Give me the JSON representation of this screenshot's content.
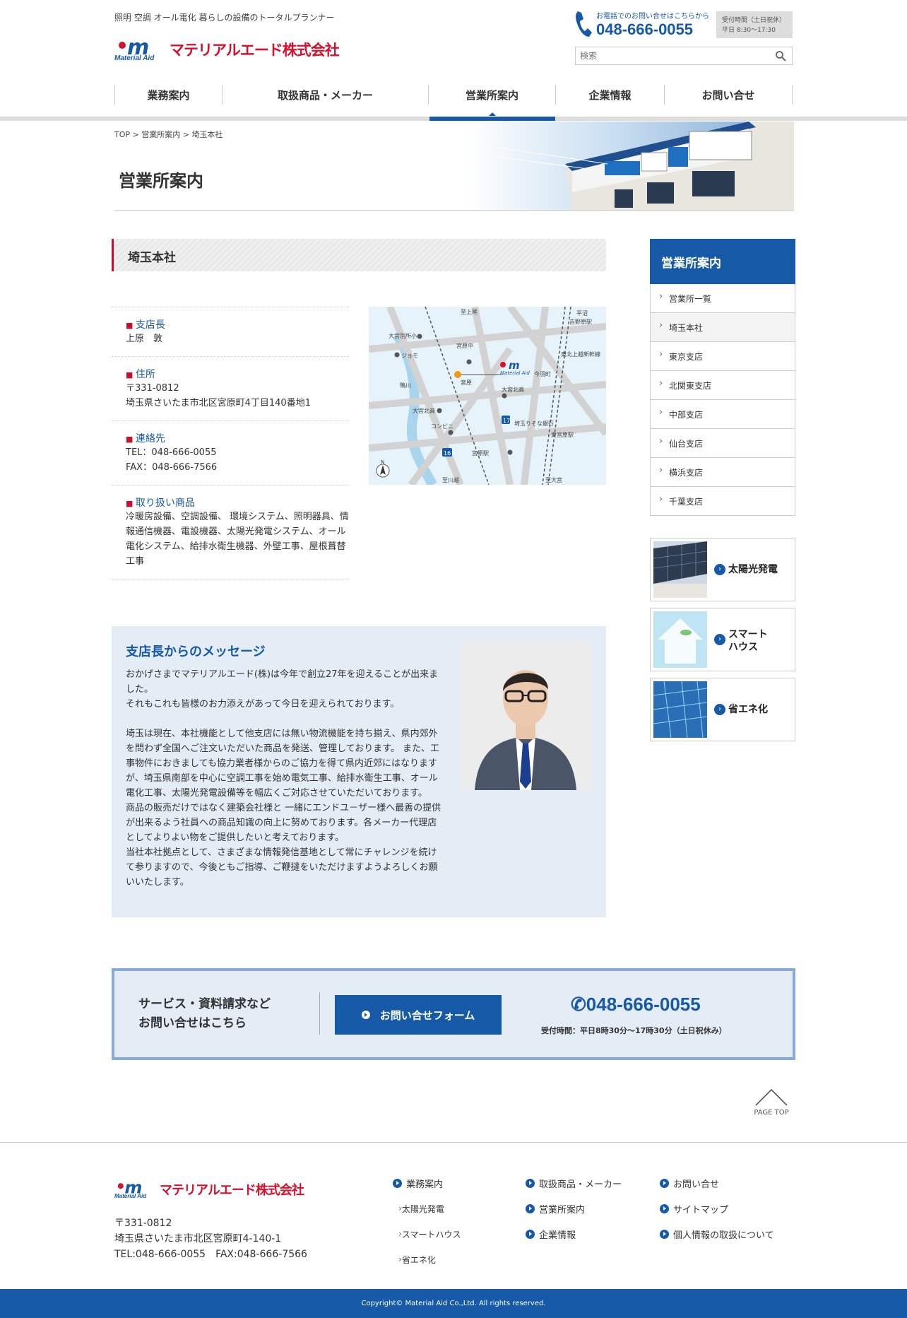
{
  "header": {
    "tagline": "照明 空調 オール電化 暮らしの設備のトータルプランナー",
    "logo_sub": "Material Aid",
    "logo_name": "マテリアルエード株式会社",
    "phone_caption": "お電話でのお問い合せはこちらから",
    "phone_number": "048-666-0055",
    "hours_line1": "受付時間（土日祝休）",
    "hours_line2": "平日 8:30～17:30",
    "search_placeholder": "検索"
  },
  "nav": {
    "items": [
      "業務案内",
      "取扱商品・メーカー",
      "営業所案内",
      "企業情報",
      "お問い合せ"
    ],
    "active": "営業所案内"
  },
  "breadcrumb": "TOP > 営業所案内 > 埼玉本社",
  "page_title": "営業所案内",
  "section": {
    "heading": "埼玉本社",
    "info": [
      {
        "label": "支店長",
        "value": "上原　敦"
      },
      {
        "label": "住所",
        "value": "〒331-0812\n埼玉県さいたま市北区宮原町4丁目140番地1"
      },
      {
        "label": "連絡先",
        "value": "TEL：048-666-0055\nFAX：048-666-7566"
      },
      {
        "label": "取り扱い商品",
        "value": "冷暖房設備、空調設備、 環境システム、照明器具、情報通信機器、電設機器、太陽光発電システム、オール電化システム、給排水衛生機器、外壁工事、屋根葺替工事"
      }
    ]
  },
  "map": {
    "labels": [
      "大宮別所小",
      "ジョモ",
      "宮原中",
      "今羽町",
      "大宮北高",
      "大宮北商",
      "コンビニ",
      "埼玉りそな銀行",
      "東宮原駅",
      "宮原駅",
      "平沼",
      "吉野原駅",
      "至上尾",
      "至川越",
      "至大宮",
      "宮原",
      "鴨川",
      "東北上越新幹線"
    ],
    "roads": [
      "17",
      "16"
    ],
    "north": "N"
  },
  "message": {
    "title": "支店長からのメッセージ",
    "body": "おかげさまでマテリアルエード(株)は今年で創立27年を迎えることが出来ました。\nそれもこれも皆様のお力添えがあって今日を迎えられております。\n\n埼玉は現在、本社機能として他支店には無い物流機能を持ち揃え、県内郊外を問わず全国へご注文いただいた商品を発送、管理しております。 また、工事物件におきましても協力業者様からのご協力を得て県内近郊にはなりますが、埼玉県南部を中心に空調工事を始め電気工事、給排水衛生工事、オール電化工事、太陽光発電設備等を幅広くご対応させていただいております。\n商品の販売だけではなく建築会社様と 一緒にエンドユ－ザー様へ最善の提供が出来るよう社員への商品知識の向上に努めております。各メーカー代理店としてよりよい物をご提供したいと考えております。\n当社本社拠点として、さまざまな情報発信基地として常にチャレンジを続けて参りますので、今後ともご指導、ご鞭撻をいただけますようよろしくお願いいたします。"
  },
  "sidebar": {
    "heading": "営業所案内",
    "items": [
      "営業所一覧",
      "埼玉本社",
      "東京支店",
      "北関東支店",
      "中部支店",
      "仙台支店",
      "横浜支店",
      "千葉支店"
    ],
    "active": "埼玉本社",
    "banners": [
      "太陽光発電",
      "スマート\nハウス",
      "省エネ化"
    ]
  },
  "cta": {
    "text": "サービス・資料請求など\nお問い合せはこちら",
    "button": "お問い合せフォーム",
    "phone": "048-666-0055",
    "hours": "受付時間：平日8時30分～17時30分（土日祝休み）"
  },
  "pagetop": "PAGE TOP",
  "footer": {
    "zip": "〒331-0812",
    "address": "埼玉県さいたま市北区宮原町4-140-1",
    "tel_fax": "TEL:048-666-0055　FAX:048-666-7566",
    "col1": {
      "main": "業務案内",
      "subs": [
        "太陽光発電",
        "スマートハウス",
        "省エネ化"
      ]
    },
    "col2": [
      "取扱商品・メーカー",
      "営業所案内",
      "企業情報"
    ],
    "col3": [
      "お問い合せ",
      "サイトマップ",
      "個人情報の取扱について"
    ],
    "copyright": "Copyright© Material Aid Co.,Ltd. All rights reserved."
  },
  "colors": {
    "brand_blue": "#1659a6",
    "brand_red": "#d7112d",
    "accent_red": "#c8102e"
  }
}
